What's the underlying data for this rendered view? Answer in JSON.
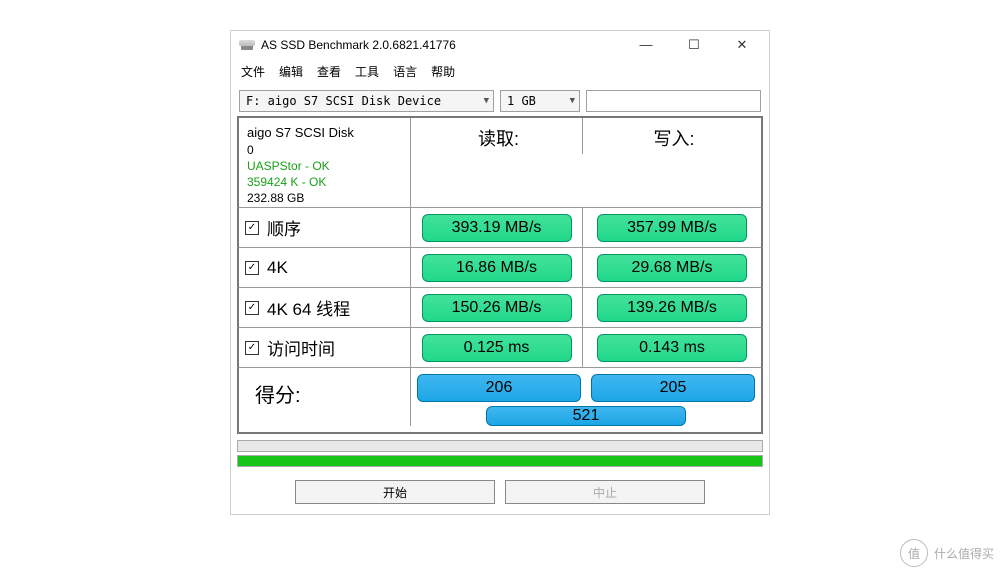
{
  "window": {
    "title": "AS SSD Benchmark 2.0.6821.41776",
    "min": "—",
    "max": "☐",
    "close": "✕"
  },
  "menu": {
    "file": "文件",
    "edit": "编辑",
    "view": "查看",
    "tools": "工具",
    "lang": "语言",
    "help": "帮助"
  },
  "toolbar": {
    "drive": "F: aigo S7 SCSI Disk Device",
    "size": "1 GB"
  },
  "device": {
    "name": "aigo S7 SCSI Disk",
    "index": "0",
    "driver": "UASPStor - OK",
    "align": "359424 K - OK",
    "capacity": "232.88 GB"
  },
  "headers": {
    "read": "读取:",
    "write": "写入:"
  },
  "tests": {
    "seq": {
      "label": "顺序",
      "read": "393.19 MB/s",
      "write": "357.99 MB/s",
      "checked": "✓"
    },
    "k4": {
      "label": "4K",
      "read": "16.86 MB/s",
      "write": "29.68 MB/s",
      "checked": "✓"
    },
    "k4t": {
      "label": "4K 64 线程",
      "read": "150.26 MB/s",
      "write": "139.26 MB/s",
      "checked": "✓"
    },
    "acc": {
      "label": "访问时间",
      "read": "0.125 ms",
      "write": "0.143 ms",
      "checked": "✓"
    }
  },
  "score": {
    "label": "得分:",
    "read": "206",
    "write": "205",
    "total": "521"
  },
  "buttons": {
    "start": "开始",
    "stop": "中止"
  },
  "watermark": {
    "glyph": "值",
    "text": "什么值得买"
  }
}
